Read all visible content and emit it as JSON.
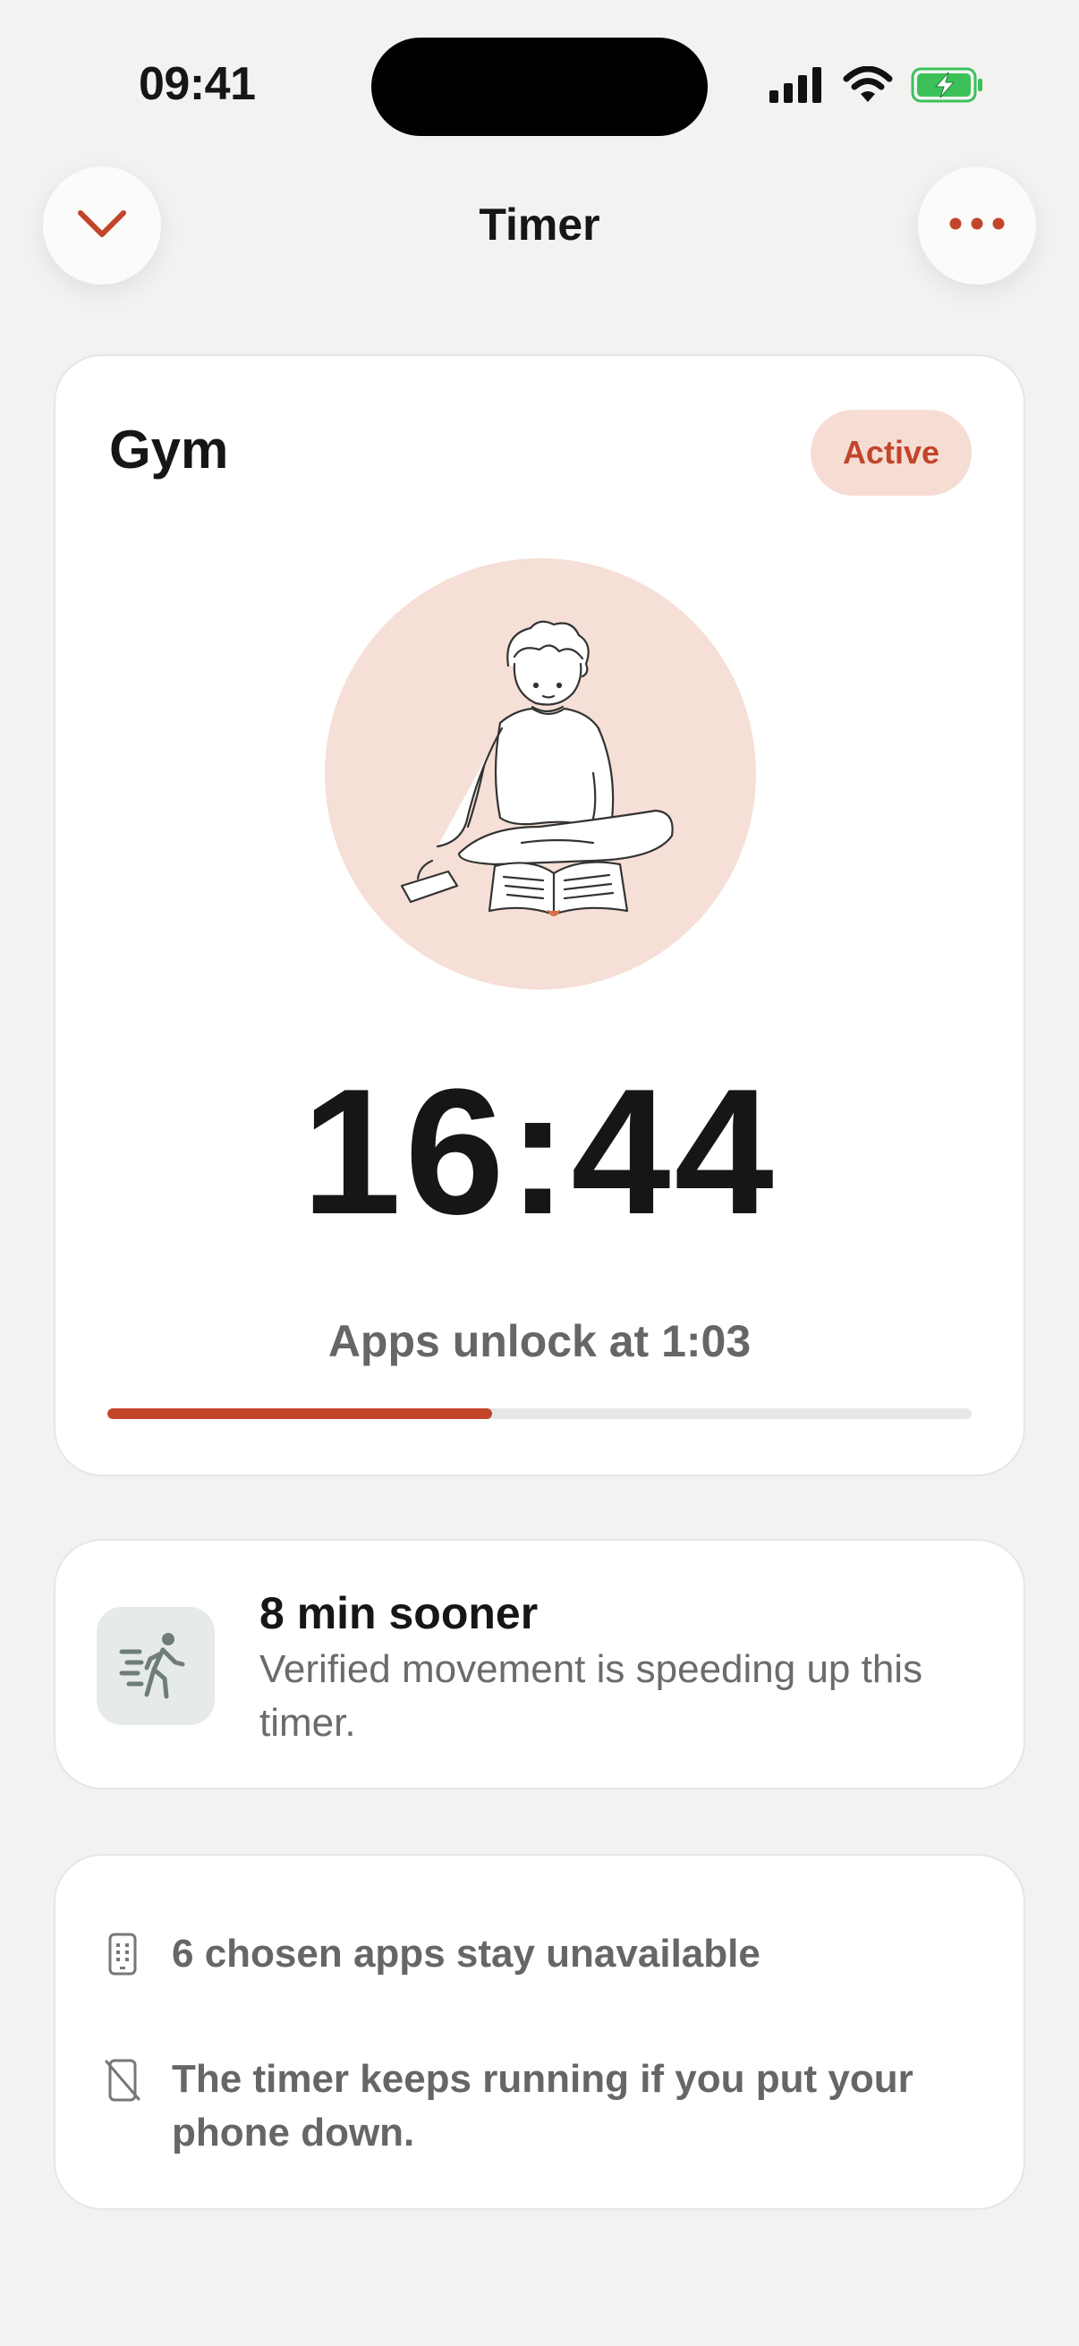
{
  "status_bar": {
    "time": "09:41"
  },
  "nav": {
    "title": "Timer"
  },
  "timer_card": {
    "title": "Gym",
    "badge": "Active",
    "time_remaining": "16:44",
    "unlock_text": "Apps unlock at 1:03",
    "progress_fraction": 0.445
  },
  "boost_card": {
    "title": "8 min sooner",
    "description": "Verified movement is speeding up this timer."
  },
  "info_card": {
    "items": [
      {
        "icon": "phone-grid-icon",
        "text": "6 chosen apps stay unavailable"
      },
      {
        "icon": "phone-off-icon",
        "text": "The timer keeps running if you put your phone down."
      }
    ]
  },
  "colors": {
    "accent": "#c2452b",
    "badge_bg": "#f6ddd4",
    "illustration_bg": "#f5dfd6",
    "background": "#f2f3f1"
  }
}
